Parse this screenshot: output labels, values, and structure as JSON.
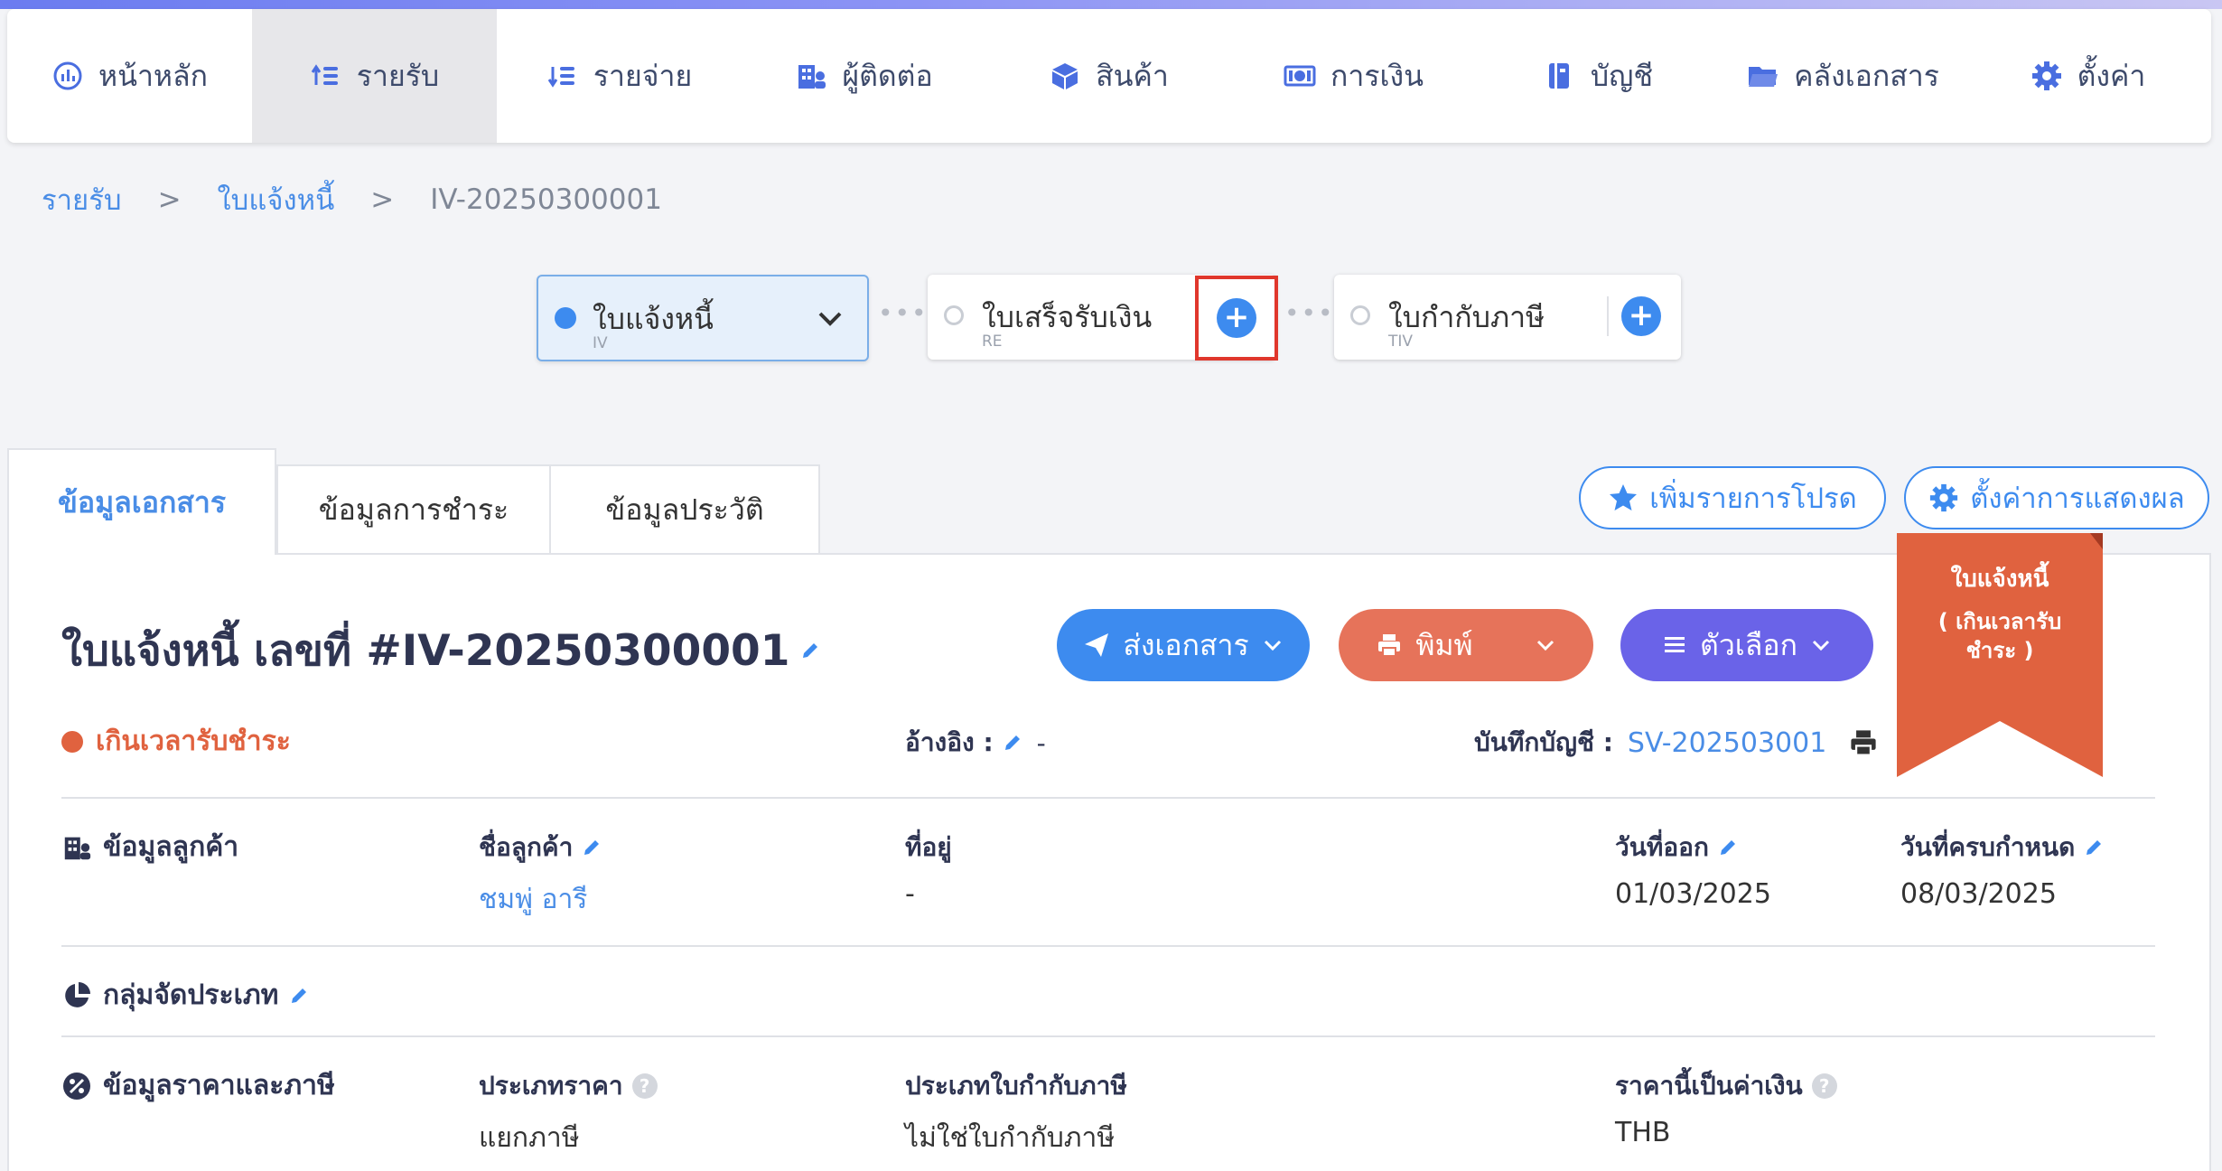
{
  "nav": {
    "items": [
      {
        "label": "หน้าหลัก",
        "icon": "dashboard-icon"
      },
      {
        "label": "รายรับ",
        "icon": "income-icon"
      },
      {
        "label": "รายจ่าย",
        "icon": "expense-icon"
      },
      {
        "label": "ผู้ติดต่อ",
        "icon": "contacts-icon"
      },
      {
        "label": "สินค้า",
        "icon": "product-box-icon"
      },
      {
        "label": "การเงิน",
        "icon": "money-icon"
      },
      {
        "label": "บัญชี",
        "icon": "ledger-icon"
      },
      {
        "label": "คลังเอกสาร",
        "icon": "folder-icon"
      },
      {
        "label": "ตั้งค่า",
        "icon": "gear-icon"
      }
    ],
    "active": "รายรับ"
  },
  "breadcrumb": {
    "level1": "รายรับ",
    "sep": ">",
    "level2": "ใบแจ้งหนี้",
    "current": "IV-20250300001"
  },
  "flow": {
    "invoice": {
      "title": "ใบแจ้งหนี้",
      "code": "IV"
    },
    "receipt": {
      "title": "ใบเสร็จรับเงิน",
      "code": "RE"
    },
    "taxinvoice": {
      "title": "ใบกำกับภาษี",
      "code": "TIV"
    },
    "plus": "+",
    "dots": "•••"
  },
  "tabs": [
    "ข้อมูลเอกสาร",
    "ข้อมูลการชำระ",
    "ข้อมูลประวัติ"
  ],
  "buttons": {
    "favorite": "เพิ่มรายการโปรด",
    "display_settings": "ตั้งค่าการแสดงผล",
    "send": "ส่งเอกสาร",
    "print": "พิมพ์",
    "options": "ตัวเลือก"
  },
  "ribbon": {
    "line1": "ใบแจ้งหนี้",
    "line2": "( เกินเวลารับ",
    "line3": "ชำระ )",
    "color": "#e0623f"
  },
  "doc": {
    "title": "ใบแจ้งหนี้ เลขที่ #IV-20250300001",
    "status": "เกินเวลารับชำระ",
    "reference_label": "อ้างอิง :",
    "reference_value": "-",
    "account_label": "บันทึกบัญชี :",
    "account_value": "SV-202503001"
  },
  "customer": {
    "section": "ข้อมูลลูกค้า",
    "name_label": "ชื่อลูกค้า",
    "name_value": "ชมพู่ อารี",
    "address_label": "ที่อยู่",
    "address_value": "-",
    "issue_label": "วันที่ออก",
    "issue_value": "01/03/2025",
    "due_label": "วันที่ครบกำหนด",
    "due_value": "08/03/2025"
  },
  "category": {
    "section": "กลุ่มจัดประเภท"
  },
  "pricing": {
    "section": "ข้อมูลราคาและภาษี",
    "price_type_label": "ประเภทราคา",
    "price_type_value": "แยกภาษี",
    "tax_invoice_type_label": "ประเภทใบกำกับภาษี",
    "tax_invoice_type_value": "ไม่ใช่ใบกำกับภาษี",
    "currency_label": "ราคานี้เป็นค่าเงิน",
    "currency_value": "THB"
  },
  "colors": {
    "accent": "#3d8bef",
    "print": "#e6735a",
    "options": "#6a63e8",
    "danger": "#e0623f"
  }
}
